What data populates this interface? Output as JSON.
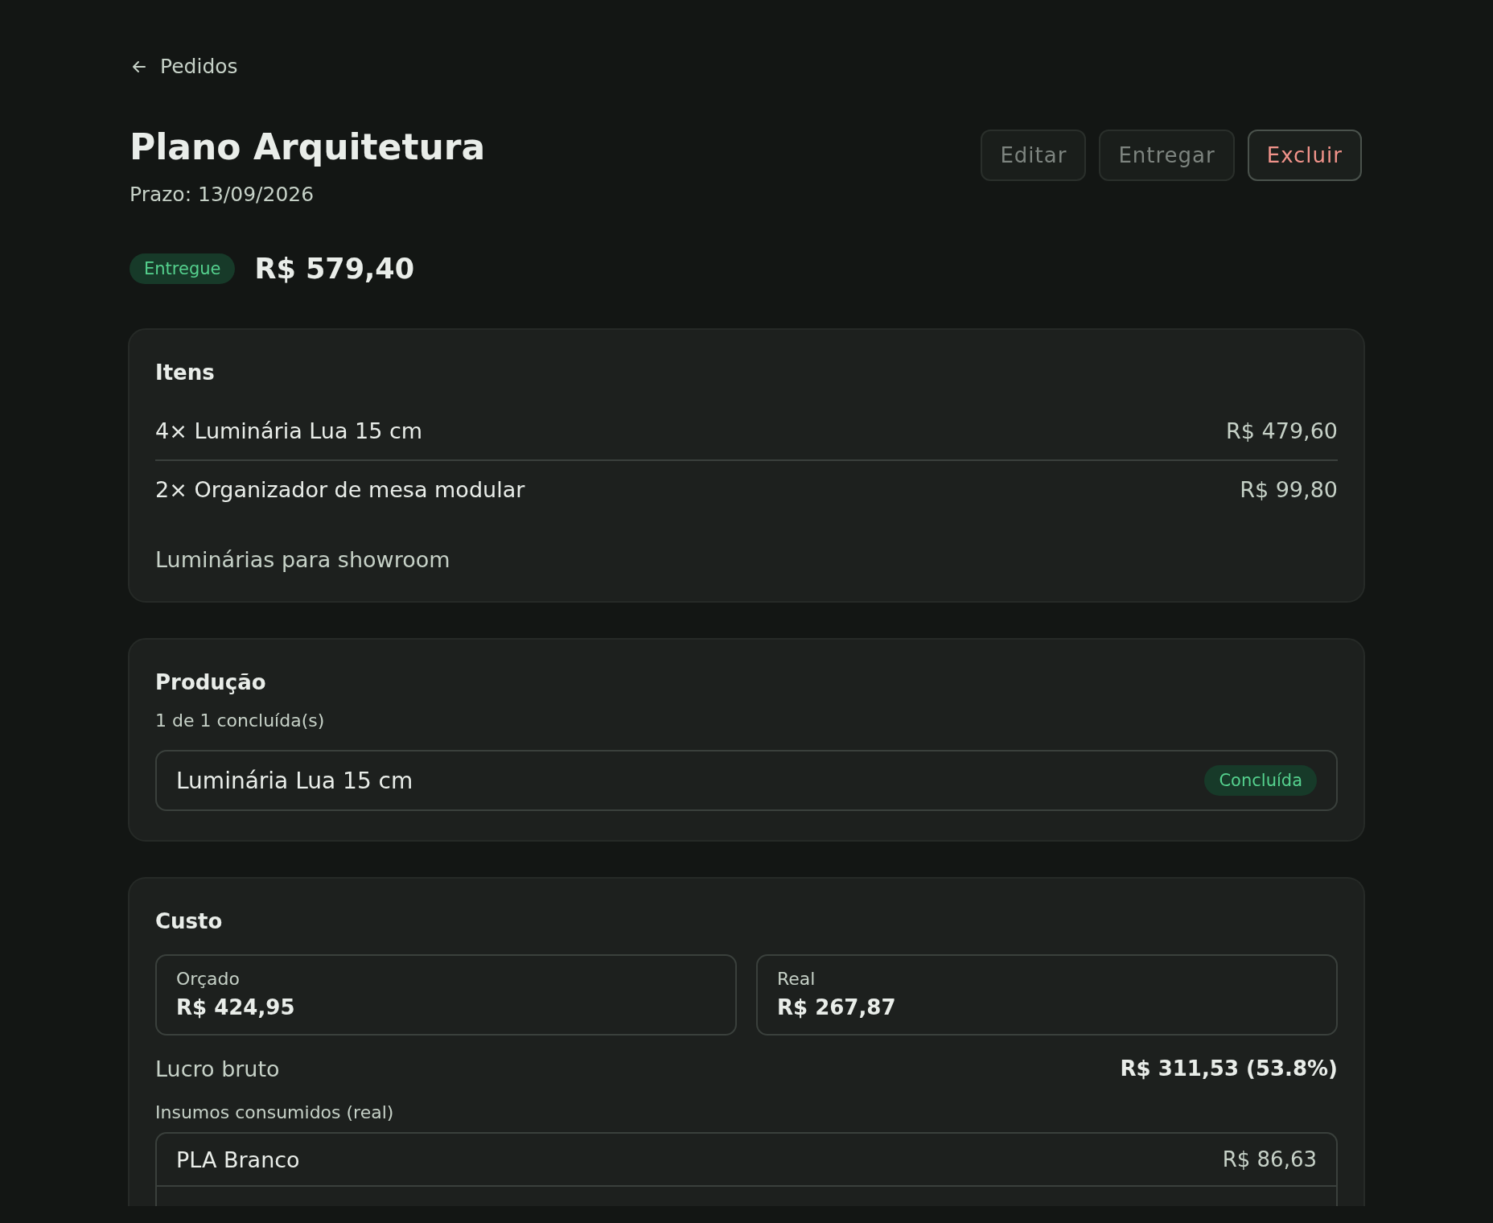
{
  "back_link": {
    "label": "Pedidos"
  },
  "header": {
    "title": "Plano Arquitetura",
    "deadline": "Prazo: 13/09/2026"
  },
  "actions": [
    {
      "label": "Editar",
      "kind": "neutral",
      "disabled": true
    },
    {
      "label": "Entregar",
      "kind": "neutral",
      "disabled": true
    },
    {
      "label": "Excluir",
      "kind": "danger",
      "disabled": false
    }
  ],
  "status": {
    "label": "Entregue",
    "kind": "success"
  },
  "total": "R$ 579,40",
  "items_card": {
    "title": "Itens",
    "items": [
      {
        "name": "4× Luminária Lua 15 cm",
        "price": "R$ 479,60"
      },
      {
        "name": "2× Organizador de mesa modular",
        "price": "R$ 99,80"
      }
    ],
    "note": "Luminárias para showroom"
  },
  "production_card": {
    "title": "Produção",
    "summary": "1 de 1 concluída(s)",
    "tasks": [
      {
        "name": "Luminária Lua 15 cm",
        "status": {
          "label": "Concluída",
          "kind": "success"
        }
      }
    ]
  },
  "cost_card": {
    "title": "Custo",
    "boxes": [
      {
        "label": "Orçado",
        "value": "R$ 424,95"
      },
      {
        "label": "Real",
        "value": "R$ 267,87"
      }
    ],
    "profit": {
      "label": "Lucro bruto",
      "value": "R$ 311,53 (53.8%)"
    },
    "materials": {
      "title": "Insumos consumidos (real)",
      "rows": [
        {
          "name": "PLA Branco",
          "cost": "R$ 86,63"
        }
      ]
    }
  }
}
